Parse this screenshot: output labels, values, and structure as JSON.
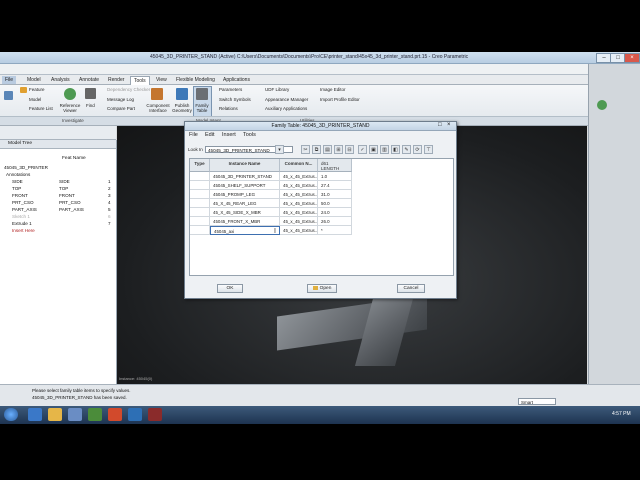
{
  "window": {
    "title": "45045_3D_PRINTER_STAND (Active) C:\\Users\\Documents\\Documents\\Pro\\CE\\printer_stand\\45x45_3d_printer_stand.prt.15 - Creo Parametric"
  },
  "ribbon": {
    "tabs": [
      "File",
      "Model",
      "Analysis",
      "Annotate",
      "Render",
      "Tools",
      "View",
      "Flexible Modeling",
      "Applications"
    ],
    "active_tab": "Tools",
    "items": [
      "Feature",
      "Model",
      "Feature List",
      "Reference Viewer",
      "Find",
      "Dependency Checker",
      "Message Log",
      "Compare Part",
      "Component Interface",
      "Publish Geometry",
      "Family Table",
      "Parameters",
      "Switch Symbols",
      "Relations",
      "UDF Library",
      "Appearance Manager",
      "Auxiliary Applications",
      "Image Editor",
      "Import Profile Editor"
    ],
    "groups": [
      "Investigate",
      "Model Intent",
      "Utilities"
    ]
  },
  "model_tree": {
    "header": "Model Tree",
    "column_feat_name": "Feat Name",
    "rows": [
      {
        "name": "45045_3D_PRINTER",
        "feat": "",
        "num": ""
      },
      {
        "name": "Annotations",
        "feat": "",
        "num": ""
      },
      {
        "name": "SIDE",
        "feat": "SIDE",
        "num": "1"
      },
      {
        "name": "TOP",
        "feat": "TOP",
        "num": "2"
      },
      {
        "name": "FRONT",
        "feat": "FRONT",
        "num": "3"
      },
      {
        "name": "PRT_CSO",
        "feat": "PRT_CSO",
        "num": "4"
      },
      {
        "name": "PART_AXIS",
        "feat": "PART_AXIS",
        "num": "5"
      },
      {
        "name": "Sketch 1",
        "feat": "",
        "num": "6"
      },
      {
        "name": "Extrude 1",
        "feat": "",
        "num": "7"
      },
      {
        "name": "Insert Here",
        "feat": "",
        "num": ""
      }
    ]
  },
  "dialog": {
    "title": "Family Table: 45045_3D_PRINTER_STAND",
    "menus": [
      "File",
      "Edit",
      "Insert",
      "Tools"
    ],
    "look_in_label": "Look In",
    "look_in_value": "45045_3D_PRINTER_STAND",
    "columns": {
      "type": "Type",
      "instance": "Instance Name",
      "common": "Common N...",
      "d61": "d61",
      "length": "LENGTH"
    },
    "rows": [
      {
        "instance": "45045_3D_PRINTER_STAND",
        "common": "45_x_45_Extrus...",
        "value": "1.0"
      },
      {
        "instance": "45045_SHELF_SUPPORT",
        "common": "45_x_45_Extrus...",
        "value": "27.4"
      },
      {
        "instance": "45045_PROMP_LEG",
        "common": "45_x_45_Extrus...",
        "value": "31.0"
      },
      {
        "instance": "45_X_45_REAR_LEG",
        "common": "45_x_45_Extrus...",
        "value": "50.0"
      },
      {
        "instance": "45_X_45_SIDE_X_MBR",
        "common": "45_x_45_Extrus...",
        "value": "24.0"
      },
      {
        "instance": "45045_FRONT_X_MBR",
        "common": "45_x_45_Extrus...",
        "value": "26.0"
      },
      {
        "instance": "45045_axi",
        "common": "45_x_45_Extrus...",
        "value": "*"
      }
    ],
    "buttons": {
      "ok": "OK",
      "open": "Open",
      "cancel": "Cancel"
    }
  },
  "status": {
    "line1": "Please select family table items to specify values.",
    "line2": "45045_3D_PRINTER_STAND has been saved.",
    "filter": "Smart",
    "graphics_label": "Instance: 45045(0)"
  },
  "taskbar": {
    "time": "4:57 PM"
  },
  "colors": {
    "accent": "#3d5a7a",
    "dialog_bg": "#eef1f4",
    "graphics_bg": "#1c1e20"
  }
}
